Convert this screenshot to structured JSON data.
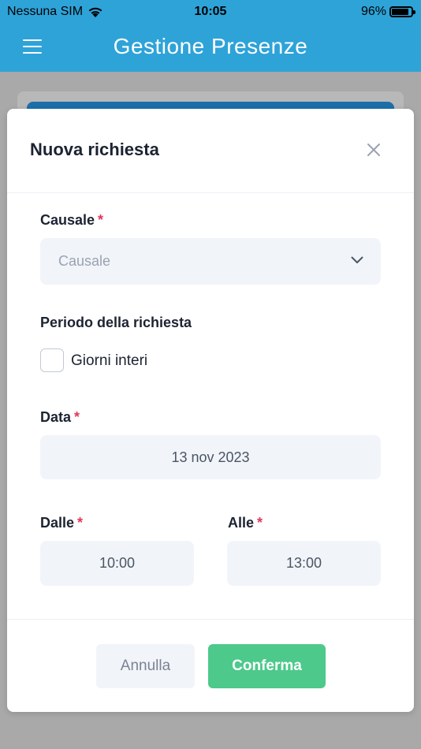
{
  "status_bar": {
    "carrier": "Nessuna SIM",
    "time": "10:05",
    "battery": "96%",
    "battery_level": 0.96
  },
  "app_bar": {
    "title": "Gestione Presenze",
    "menu_icon": "hamburger-menu-icon"
  },
  "modal": {
    "title": "Nuova richiesta",
    "close_icon": "close-icon",
    "causale": {
      "label": "Causale",
      "required_mark": "*",
      "placeholder": "Causale"
    },
    "periodo": {
      "label": "Periodo della richiesta",
      "checkbox_label": "Giorni interi",
      "checked": false
    },
    "data": {
      "label": "Data",
      "required_mark": "*",
      "value": "13 nov 2023"
    },
    "dalle": {
      "label": "Dalle",
      "required_mark": "*",
      "value": "10:00"
    },
    "alle": {
      "label": "Alle",
      "required_mark": "*",
      "value": "13:00"
    },
    "buttons": {
      "cancel": "Annulla",
      "confirm": "Conferma"
    }
  },
  "colors": {
    "app_bar": "#2ea3d8",
    "confirm": "#4cc98b",
    "required": "#e0375b"
  }
}
